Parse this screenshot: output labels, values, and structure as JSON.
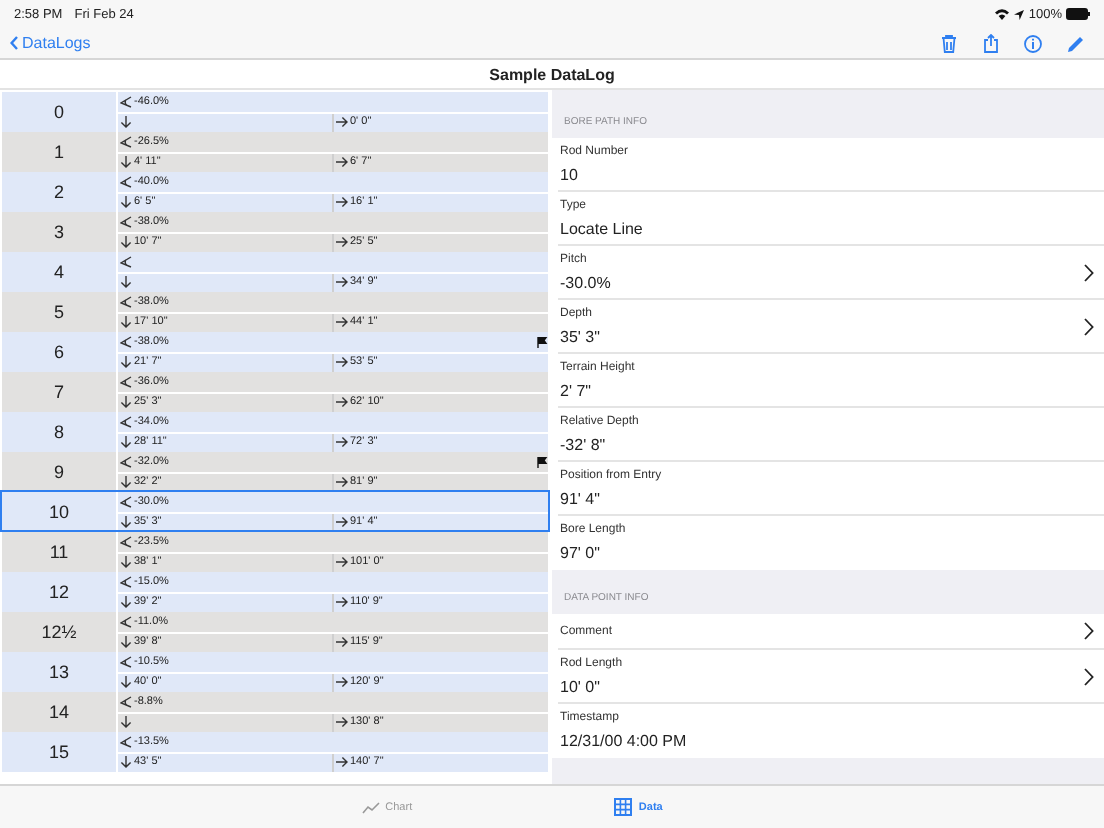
{
  "status_bar": {
    "time": "2:58 PM",
    "date": "Fri Feb 24",
    "battery": "100%"
  },
  "nav": {
    "back": "DataLogs",
    "title": "Sample DataLog"
  },
  "rods": [
    {
      "number": "0",
      "pitch": "-46.0%",
      "position": "0' 0\"",
      "flagged": false,
      "selected": false
    },
    {
      "number": "1",
      "pitch": "-26.5%",
      "depth": "4' 11\"",
      "position": "6' 7\"",
      "flagged": false,
      "selected": false
    },
    {
      "number": "2",
      "pitch": "-40.0%",
      "depth": "6' 5\"",
      "position": "16' 1\"",
      "flagged": false,
      "selected": false
    },
    {
      "number": "3",
      "pitch": "-38.0%",
      "depth": "10' 7\"",
      "position": "25' 5\"",
      "flagged": false,
      "selected": false
    },
    {
      "number": "4",
      "position": "34' 9\"",
      "flagged": false,
      "selected": false
    },
    {
      "number": "5",
      "pitch": "-38.0%",
      "depth": "17' 10\"",
      "position": "44' 1\"",
      "flagged": false,
      "selected": false
    },
    {
      "number": "6",
      "pitch": "-38.0%",
      "depth": "21' 7\"",
      "position": "53' 5\"",
      "flagged": true,
      "selected": false
    },
    {
      "number": "7",
      "pitch": "-36.0%",
      "depth": "25' 3\"",
      "position": "62' 10\"",
      "flagged": false,
      "selected": false
    },
    {
      "number": "8",
      "pitch": "-34.0%",
      "depth": "28' 11\"",
      "position": "72' 3\"",
      "flagged": false,
      "selected": false
    },
    {
      "number": "9",
      "pitch": "-32.0%",
      "depth": "32' 2\"",
      "position": "81' 9\"",
      "flagged": true,
      "selected": false
    },
    {
      "number": "10",
      "pitch": "-30.0%",
      "depth": "35' 3\"",
      "position": "91' 4\"",
      "flagged": false,
      "selected": true
    },
    {
      "number": "11",
      "pitch": "-23.5%",
      "depth": "38' 1\"",
      "position": "101' 0\"",
      "flagged": false,
      "selected": false
    },
    {
      "number": "12",
      "pitch": "-15.0%",
      "depth": "39' 2\"",
      "position": "110' 9\"",
      "flagged": false,
      "selected": false
    },
    {
      "number": "12½",
      "pitch": "-11.0%",
      "depth": "39' 8\"",
      "position": "115' 9\"",
      "flagged": false,
      "selected": false
    },
    {
      "number": "13",
      "pitch": "-10.5%",
      "depth": "40' 0\"",
      "position": "120' 9\"",
      "flagged": false,
      "selected": false
    },
    {
      "number": "14",
      "pitch": "-8.8%",
      "position": "130' 8\"",
      "flagged": false,
      "selected": false
    },
    {
      "number": "15",
      "pitch": "-13.5%",
      "depth": "43' 5\"",
      "position": "140' 7\"",
      "flagged": false,
      "selected": false
    }
  ],
  "sections": [
    {
      "header": "BORE PATH INFO",
      "items": [
        {
          "label": "Rod Number",
          "value": "10",
          "disclosure": false
        },
        {
          "label": "Type",
          "value": "Locate Line",
          "disclosure": false
        },
        {
          "label": "Pitch",
          "value": "-30.0%",
          "disclosure": true
        },
        {
          "label": "Depth",
          "value": "35' 3\"",
          "disclosure": true
        },
        {
          "label": "Terrain Height",
          "value": "2' 7\"",
          "disclosure": false
        },
        {
          "label": "Relative Depth",
          "value": "-32' 8\"",
          "disclosure": false
        },
        {
          "label": "Position from Entry",
          "value": "91' 4\"",
          "disclosure": false
        },
        {
          "label": "Bore Length",
          "value": "97' 0\"",
          "disclosure": false
        }
      ]
    },
    {
      "header": "DATA POINT INFO",
      "items": [
        {
          "label": "Comment",
          "disclosure": true
        },
        {
          "label": "Rod Length",
          "value": "10' 0\"",
          "disclosure": true
        },
        {
          "label": "Timestamp",
          "value": "12/31/00 4:00 PM",
          "disclosure": false
        }
      ]
    }
  ],
  "tabs": [
    {
      "label": "Chart",
      "kind": "chart",
      "selected": false
    },
    {
      "label": "Data",
      "kind": "grid",
      "selected": true
    }
  ]
}
